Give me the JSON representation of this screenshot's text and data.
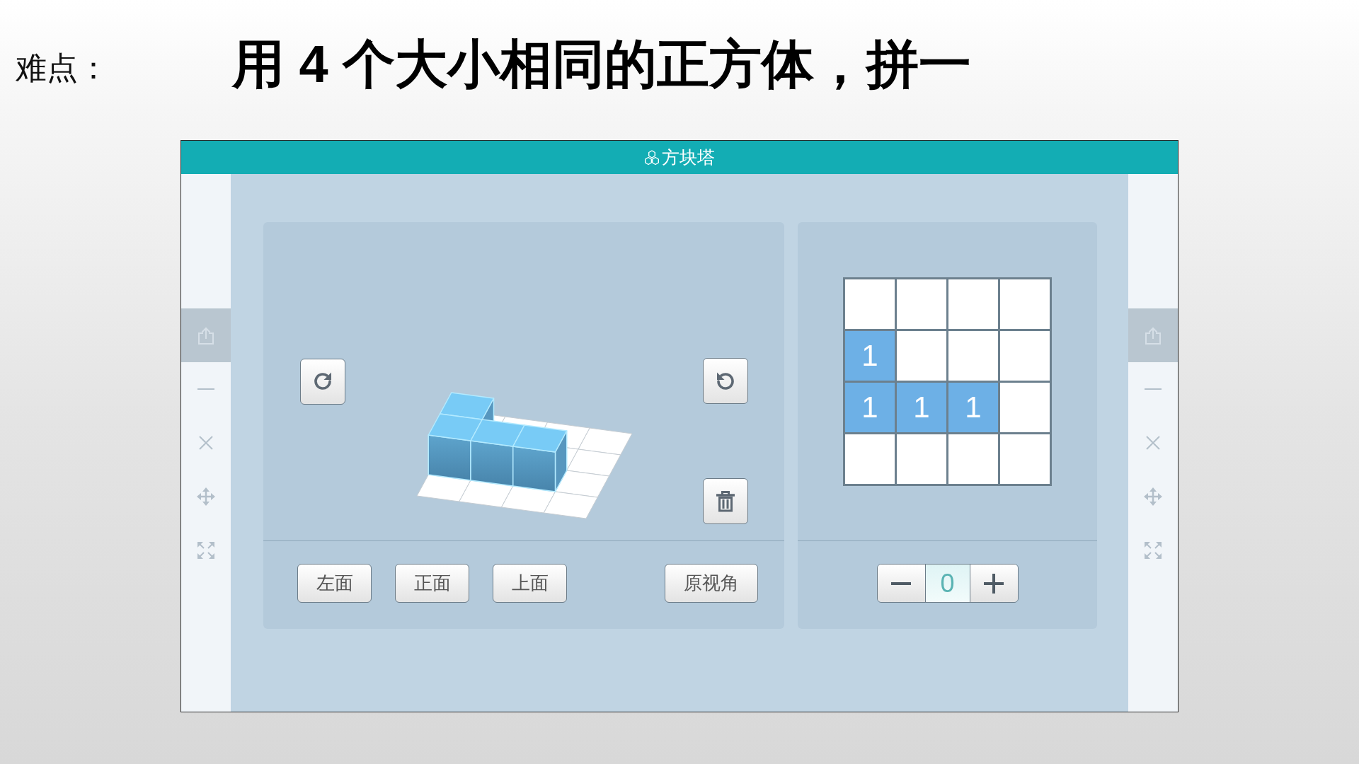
{
  "slide": {
    "label": "难点：",
    "title": "用 4 个大小相同的正方体，拼一"
  },
  "app": {
    "title": "方块塔",
    "left_toolbar": {
      "items": [
        {
          "kind": "share",
          "highlighted": true
        },
        {
          "kind": "minimize",
          "highlighted": false
        },
        {
          "kind": "close",
          "highlighted": false
        },
        {
          "kind": "move",
          "highlighted": false
        },
        {
          "kind": "fullscreen",
          "highlighted": false
        }
      ]
    },
    "view_panel": {
      "view_buttons": [
        "左面",
        "正面",
        "上面"
      ],
      "reset_view_button": "原视角"
    },
    "top_view": {
      "rows": [
        [
          {
            "filled": false
          },
          {
            "filled": false
          },
          {
            "filled": false
          },
          {
            "filled": false
          }
        ],
        [
          {
            "filled": true,
            "value": "1"
          },
          {
            "filled": false
          },
          {
            "filled": false
          },
          {
            "filled": false
          }
        ],
        [
          {
            "filled": true,
            "value": "1"
          },
          {
            "filled": true,
            "value": "1"
          },
          {
            "filled": true,
            "value": "1"
          },
          {
            "filled": false
          }
        ],
        [
          {
            "filled": false
          },
          {
            "filled": false
          },
          {
            "filled": false
          },
          {
            "filled": false
          }
        ]
      ]
    },
    "counter": {
      "value": "0"
    },
    "right_toolbar": {
      "items": [
        {
          "kind": "share",
          "highlighted": true
        },
        {
          "kind": "minimize",
          "highlighted": false
        },
        {
          "kind": "close",
          "highlighted": false
        },
        {
          "kind": "move",
          "highlighted": false
        },
        {
          "kind": "fullscreen",
          "highlighted": false
        }
      ]
    }
  }
}
